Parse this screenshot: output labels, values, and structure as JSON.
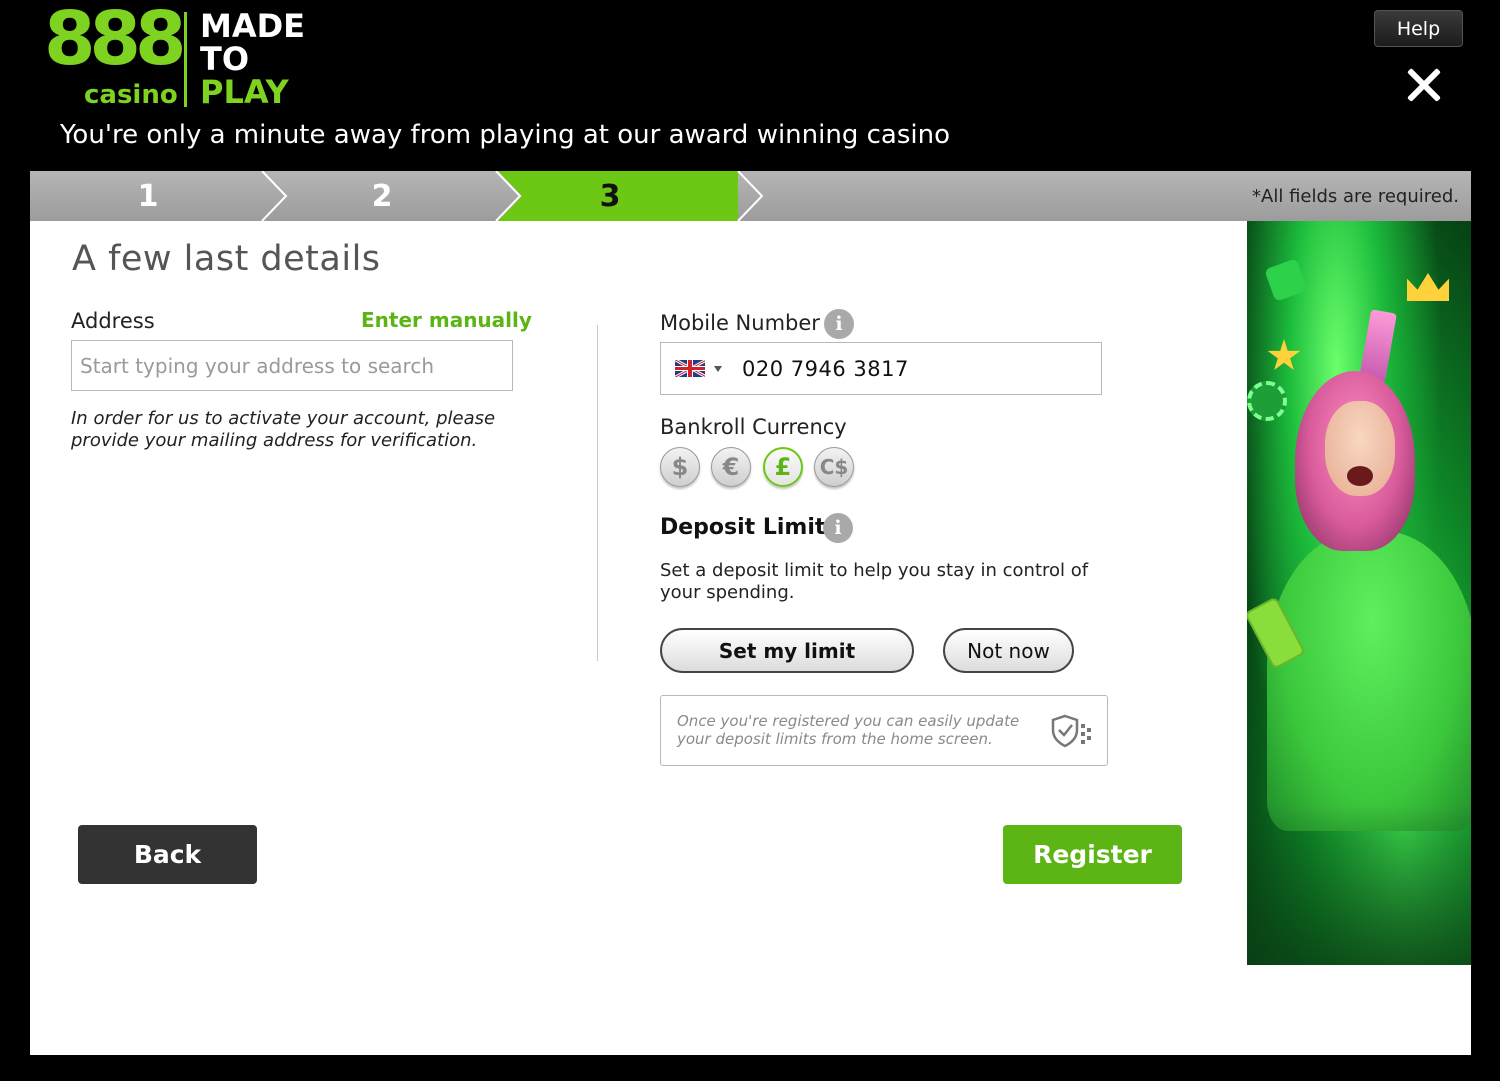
{
  "brand": {
    "logo_number": "888",
    "logo_sub": "casino",
    "slogan_line1": "MADE",
    "slogan_line2": "TO",
    "slogan_line3": "PLAY",
    "accent_color": "#7ed321"
  },
  "header": {
    "help_label": "Help",
    "close_icon": "close-icon",
    "tagline": "You're only a minute away from playing at our award winning casino"
  },
  "steps": {
    "items": [
      "1",
      "2",
      "3"
    ],
    "active": "3",
    "required_note": "*All fields are required."
  },
  "form": {
    "title": "A few last details",
    "address": {
      "label": "Address",
      "enter_manually": "Enter manually",
      "placeholder": "Start typing your address to search",
      "value": "",
      "note": "In order for us to activate your account, please provide your mailing address for verification."
    },
    "mobile": {
      "label": "Mobile Number",
      "info_icon": "i",
      "country_flag": "uk-flag-icon",
      "value": "020 7946 3817"
    },
    "currency": {
      "label": "Bankroll Currency",
      "options": [
        "$",
        "€",
        "£",
        "C$"
      ],
      "selected": "£"
    },
    "deposit_limit": {
      "title": "Deposit Limit",
      "info_icon": "i",
      "description": "Set a deposit limit to help you stay in control of your spending.",
      "set_limit_label": "Set my limit",
      "not_now_label": "Not now",
      "info_box_text": "Once you're registered you can easily update your deposit limits from the home screen.",
      "info_box_icon": "shield-check-icon"
    }
  },
  "actions": {
    "back_label": "Back",
    "register_label": "Register",
    "register_color": "#5cb514"
  },
  "promo": {
    "image_description_icon": "promo-image"
  }
}
